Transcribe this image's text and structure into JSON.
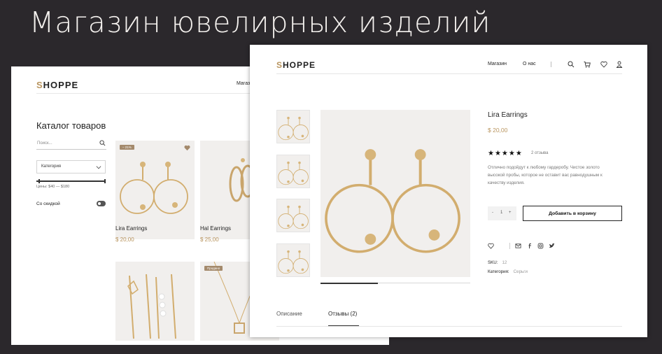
{
  "heading": "Магазин ювелирных изделий",
  "colors": {
    "background": "#2b282c",
    "accent": "#b9955f",
    "badge": "#a48a6c"
  },
  "catalog": {
    "logo_first": "S",
    "logo_rest": "HOPPE",
    "nav_shop": "Магазин",
    "title": "Каталог товаров",
    "search_placeholder": "Поиск...",
    "category_label": "Категория",
    "price_range": "Цены: $40 — $180",
    "discount_label": "Со скидкой",
    "products": [
      {
        "name": "Lira Earrings",
        "price": "$ 20,00",
        "badge": "– 21%"
      },
      {
        "name": "Hal Earrings",
        "price": "$ 25,00"
      },
      {
        "name": "",
        "price": ""
      },
      {
        "name": "",
        "price": "",
        "badge": "Продано"
      }
    ]
  },
  "product_page": {
    "logo_first": "S",
    "logo_rest": "HOPPE",
    "nav": {
      "shop": "Магазин",
      "about": "О нас"
    },
    "icons": [
      "search-icon",
      "cart-icon",
      "heart-icon",
      "user-icon"
    ],
    "name": "Lira Earrings",
    "price": "$ 20,00",
    "rating": "★★★★★",
    "reviews": "2 отзыва",
    "description": "Отлично подойдут к любому гардеробу. Чистое золото высокой пробы, которое не оставит вас равнодушным к качеству изделия.",
    "qty": {
      "minus": "-",
      "value": "1",
      "plus": "+"
    },
    "add_to_cart": "Добавить в корзину",
    "sku_label": "SKU:",
    "sku_value": "12",
    "category_label": "Категория:",
    "category_value": "Серьги",
    "tabs": {
      "description": "Описание",
      "reviews": "Отзывы (2)"
    }
  }
}
